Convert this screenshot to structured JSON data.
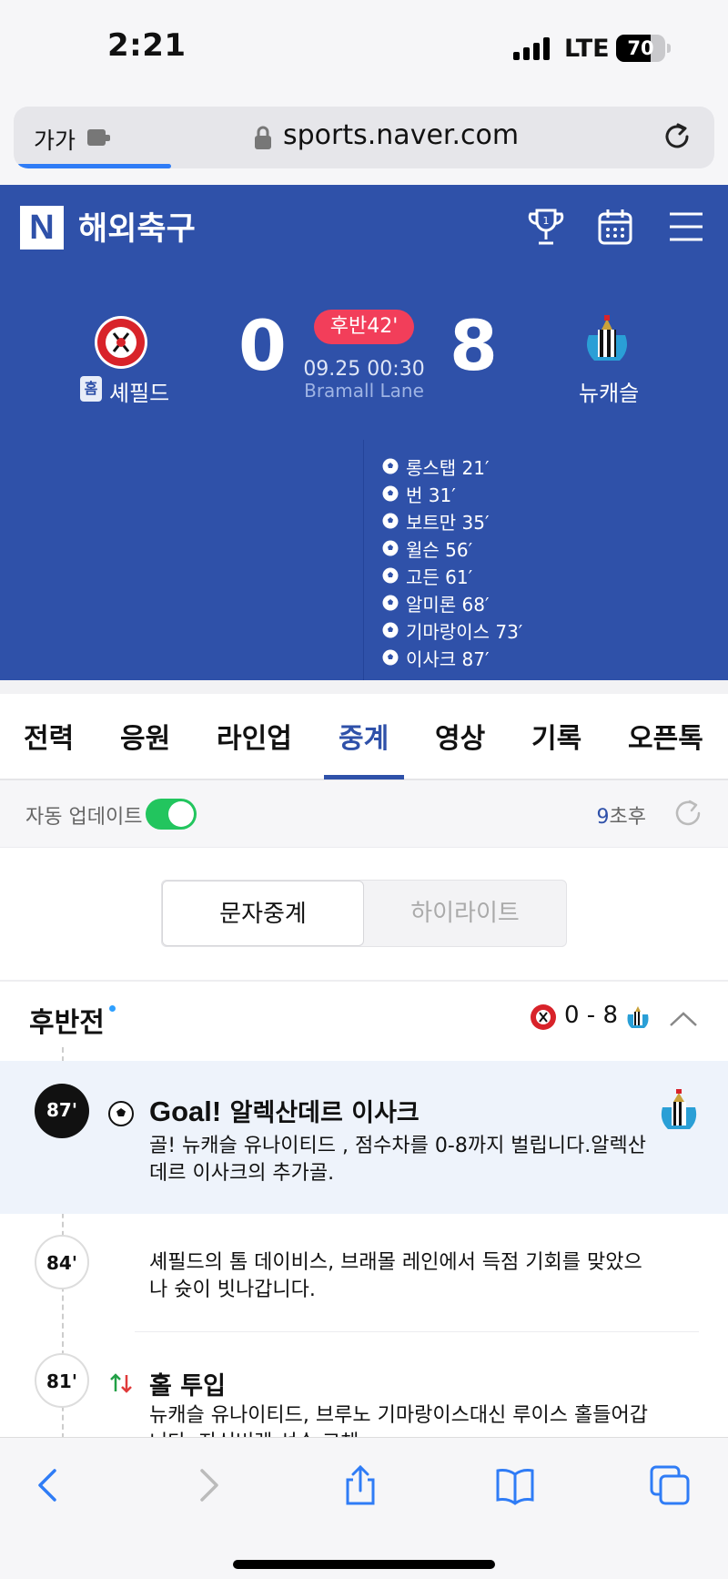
{
  "status_bar": {
    "time": "2:21",
    "network": "LTE",
    "battery": "70",
    "battery_fraction": 0.7
  },
  "browser": {
    "aa_label": "가가",
    "url": "sports.naver.com",
    "load_fraction": 0.22
  },
  "header": {
    "logo": "N",
    "title": "해외축구",
    "icons": [
      "trophy-icon",
      "calendar-icon",
      "menu-icon"
    ]
  },
  "match": {
    "home_team": "셰필드",
    "home_badge": "홈",
    "away_team": "뉴캐슬",
    "home_score": "0",
    "away_score": "8",
    "status": "후반42'",
    "datetime": "09.25 00:30",
    "venue": "Bramall Lane"
  },
  "scorers": {
    "away": [
      "롱스탭 21′",
      "번 31′",
      "보트만 35′",
      "윌슨 56′",
      "고든 61′",
      "알미론 68′",
      "기마랑이스 73′",
      "이사크 87′"
    ]
  },
  "tabs": [
    "전력",
    "응원",
    "라인업",
    "중계",
    "영상",
    "기록",
    "오픈톡"
  ],
  "active_tab": "중계",
  "auto_update": {
    "label": "자동 업데이트",
    "enabled": true,
    "countdown_num": "9",
    "countdown_suffix": "초후"
  },
  "segment": {
    "active": "문자중계",
    "inactive": "하이라이트"
  },
  "half": {
    "title": "후반전",
    "score": "0 - 8"
  },
  "events": [
    {
      "minute": "87'",
      "type": "goal",
      "title_prefix": "Goal!",
      "title": "알렉산데르 이사크",
      "text": "골! 뉴캐슬 유나이티드 , 점수차를 0-8까지 벌립니다.알렉산데르 이사크의 추가골."
    },
    {
      "minute": "84'",
      "type": "chance",
      "text": "셰필드의 톰 데이비스, 브래몰 레인에서 득점 기회를 맞았으나 슛이 빗나갑니다."
    },
    {
      "minute": "81'",
      "type": "substitution",
      "title": "홀 투입",
      "text": "뉴캐슬 유나이티드, 브루노 기마랑이스대신 루이스 홀들어갑니다. 자신버렌 선수 교체"
    }
  ],
  "colors": {
    "brand_blue": "#2f51a9",
    "live_red": "#f23e5a",
    "toggle_green": "#22c55e",
    "ios_blue": "#2f7cf6"
  },
  "toolbar_icons": [
    "back-icon",
    "forward-icon",
    "share-icon",
    "bookmarks-icon",
    "tabs-icon"
  ]
}
